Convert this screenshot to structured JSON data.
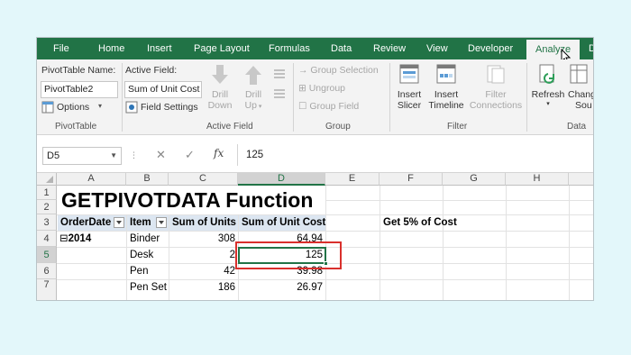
{
  "tabs": [
    "File",
    "Home",
    "Insert",
    "Page Layout",
    "Formulas",
    "Data",
    "Review",
    "View",
    "Developer",
    "Analyze",
    "D"
  ],
  "active_tab": "Analyze",
  "ribbon": {
    "pivottable": {
      "name_label": "PivotTable Name:",
      "name_value": "PivotTable2",
      "options_label": "Options",
      "group_label": "PivotTable"
    },
    "active_field": {
      "label": "Active Field:",
      "value": "Sum of Unit Cost",
      "field_settings": "Field Settings",
      "drill_down_1": "Drill",
      "drill_down_2": "Down",
      "drill_up_1": "Drill",
      "drill_up_2": "Up",
      "group_label": "Active Field"
    },
    "group": {
      "group_selection": "Group Selection",
      "ungroup": "Ungroup",
      "group_field": "Group Field",
      "group_label": "Group"
    },
    "filter": {
      "insert_slicer_1": "Insert",
      "insert_slicer_2": "Slicer",
      "insert_timeline_1": "Insert",
      "insert_timeline_2": "Timeline",
      "filter_conn_1": "Filter",
      "filter_conn_2": "Connections",
      "group_label": "Filter"
    },
    "data": {
      "refresh": "Refresh",
      "change_1": "Chang",
      "change_2": "Sou",
      "group_label": "Data"
    }
  },
  "formula_bar": {
    "name_box": "D5",
    "cancel": "✕",
    "enter": "✓",
    "fx": "fx",
    "value": "125"
  },
  "grid": {
    "columns": [
      "A",
      "B",
      "C",
      "D",
      "E",
      "F",
      "G",
      "H"
    ],
    "rows": [
      "1",
      "2",
      "3",
      "4",
      "5",
      "6",
      "7"
    ],
    "title": "GETPIVOTDATA Function",
    "headers": {
      "order_date": "OrderDate",
      "item": "Item",
      "sum_units": "Sum of Units",
      "sum_cost": "Sum of Unit Cost",
      "get_cost": "Get 5% of Cost"
    },
    "data_rows": [
      {
        "date": "2014",
        "item": "Binder",
        "units": "308",
        "cost": "64.94"
      },
      {
        "date": "",
        "item": "Desk",
        "units": "2",
        "cost": "125"
      },
      {
        "date": "",
        "item": "Pen",
        "units": "42",
        "cost": "39.98"
      },
      {
        "date": "",
        "item": "Pen Set",
        "units": "186",
        "cost": "26.97"
      }
    ],
    "collapse_symbol": "⊟"
  }
}
